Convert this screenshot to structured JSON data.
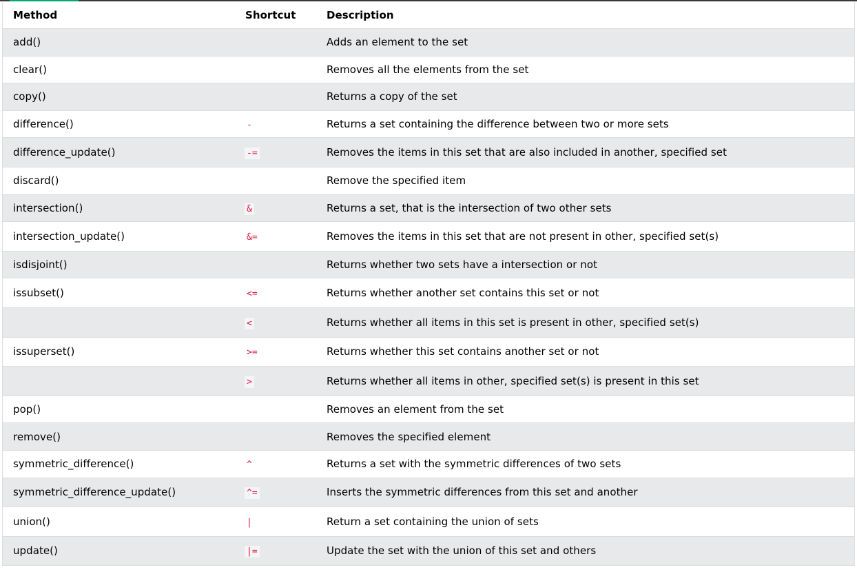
{
  "table": {
    "headers": {
      "method": "Method",
      "shortcut": "Shortcut",
      "description": "Description"
    },
    "rows": [
      {
        "method": "add()",
        "shortcut": "",
        "description": "Adds an element to the set"
      },
      {
        "method": "clear()",
        "shortcut": "",
        "description": "Removes all the elements from the set"
      },
      {
        "method": "copy()",
        "shortcut": "",
        "description": "Returns a copy of the set"
      },
      {
        "method": "difference()",
        "shortcut": "-",
        "description": "Returns a set containing the difference between two or more sets"
      },
      {
        "method": "difference_update()",
        "shortcut": "-=",
        "description": "Removes the items in this set that are also included in another, specified set"
      },
      {
        "method": "discard()",
        "shortcut": "",
        "description": "Remove the specified item"
      },
      {
        "method": "intersection()",
        "shortcut": "&",
        "description": "Returns a set, that is the intersection of two other sets"
      },
      {
        "method": "intersection_update()",
        "shortcut": "&=",
        "description": "Removes the items in this set that are not present in other, specified set(s)"
      },
      {
        "method": "isdisjoint()",
        "shortcut": "",
        "description": "Returns whether two sets have a intersection or not"
      },
      {
        "method": "issubset()",
        "shortcut": "<=",
        "description": "Returns whether another set contains this set or not"
      },
      {
        "method": "",
        "shortcut": "<",
        "description": "Returns whether all items in this set is present in other, specified set(s)"
      },
      {
        "method": "issuperset()",
        "shortcut": ">=",
        "description": "Returns whether this set contains another set or not"
      },
      {
        "method": "",
        "shortcut": ">",
        "description": "Returns whether all items in other, specified set(s) is present in this set"
      },
      {
        "method": "pop()",
        "shortcut": "",
        "description": "Removes an element from the set"
      },
      {
        "method": "remove()",
        "shortcut": "",
        "description": "Removes the specified element"
      },
      {
        "method": "symmetric_difference()",
        "shortcut": "^",
        "description": "Returns a set with the symmetric differences of two sets"
      },
      {
        "method": "symmetric_difference_update()",
        "shortcut": "^=",
        "description": "Inserts the symmetric differences from this set and another"
      },
      {
        "method": "union()",
        "shortcut": "|",
        "description": "Return a set containing the union of sets"
      },
      {
        "method": "update()",
        "shortcut": "|=",
        "description": "Update the set with the union of this set and others"
      }
    ]
  },
  "colors": {
    "accent": "#04aa6d",
    "code_text": "#dc143c",
    "row_alt": "#e7e9eb"
  }
}
